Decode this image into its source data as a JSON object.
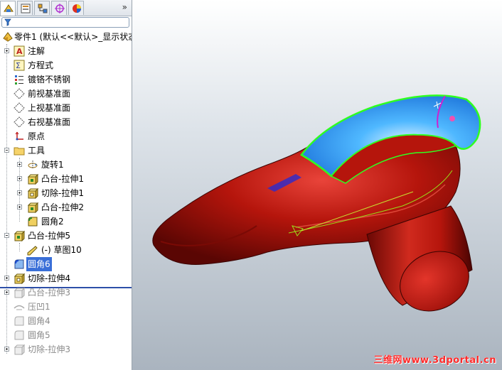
{
  "panel": {
    "more_label": "»",
    "tabs": [
      {
        "icon": "feature-manager-icon"
      },
      {
        "icon": "property-manager-icon"
      },
      {
        "icon": "configuration-manager-icon"
      },
      {
        "icon": "dimxpert-icon"
      },
      {
        "icon": "display-manager-icon"
      }
    ],
    "filter_icon": "filter-icon",
    "root_label": "零件1 (默认<<默认>_显示状态",
    "items": [
      {
        "label": "注解"
      },
      {
        "label": "方程式"
      },
      {
        "label": "镀铬不锈钢"
      },
      {
        "label": "前视基准面"
      },
      {
        "label": "上视基准面"
      },
      {
        "label": "右视基准面"
      },
      {
        "label": "原点"
      },
      {
        "label": "工具"
      },
      {
        "label": "旋转1"
      },
      {
        "label": "凸台-拉伸1"
      },
      {
        "label": "切除-拉伸1"
      },
      {
        "label": "凸台-拉伸2"
      },
      {
        "label": "圆角2"
      },
      {
        "label": "凸台-拉伸5"
      },
      {
        "label": "(-) 草图10"
      },
      {
        "label": "圆角6"
      },
      {
        "label": "切除-拉伸4"
      },
      {
        "label": "凸台-拉伸3"
      },
      {
        "label": "压凹1"
      },
      {
        "label": "圆角4"
      },
      {
        "label": "圆角5"
      },
      {
        "label": "切除-拉伸3"
      }
    ]
  },
  "viewport": {
    "watermark": "三维网www.3dportal.cn",
    "model_color": "#b5150c",
    "highlight_face_color": "#1fa3ff",
    "edge_highlight_color": "#33ff22"
  }
}
